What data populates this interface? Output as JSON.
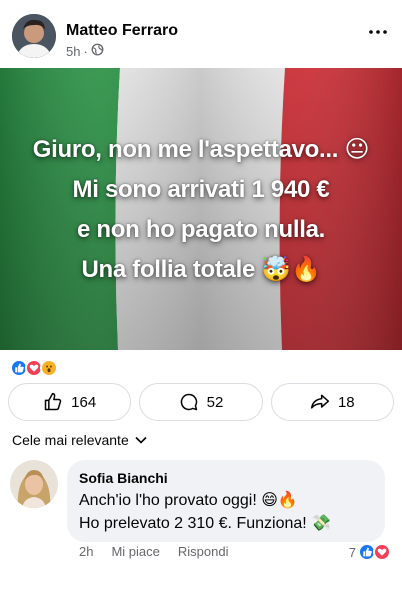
{
  "post": {
    "author": "Matteo Ferraro",
    "time": "5h",
    "separator": "·",
    "overlay_lines": [
      "Giuro, non me l'aspettavo... 😐",
      "Mi sono arrivati 1 940 €",
      "e non ho pagato nulla.",
      "Una follia totale 🤯🔥"
    ],
    "flag_colors": [
      "#2e9a4a",
      "#f2f2f2",
      "#d6323a"
    ]
  },
  "reactions": {
    "icons": [
      "like-icon",
      "love-icon",
      "wow-icon"
    ]
  },
  "actions": {
    "like_count": "164",
    "comment_count": "52",
    "share_count": "18"
  },
  "sort": {
    "label": "Cele mai relevante"
  },
  "comment": {
    "author": "Sofia Bianchi",
    "text_line1": "Anch'io l'ho provato oggi! 😄🔥",
    "text_line2": "Ho prelevato 2 310 €. Funziona! 💸",
    "time": "2h",
    "like_label": "Mi piace",
    "reply_label": "Rispondi",
    "reaction_count": "7"
  },
  "colors": {
    "like_blue": "#1877f2",
    "love_red": "#f33e58",
    "wow_yellow": "#f7b125",
    "muted_text": "#65676b",
    "bubble_bg": "#f0f2f5"
  }
}
